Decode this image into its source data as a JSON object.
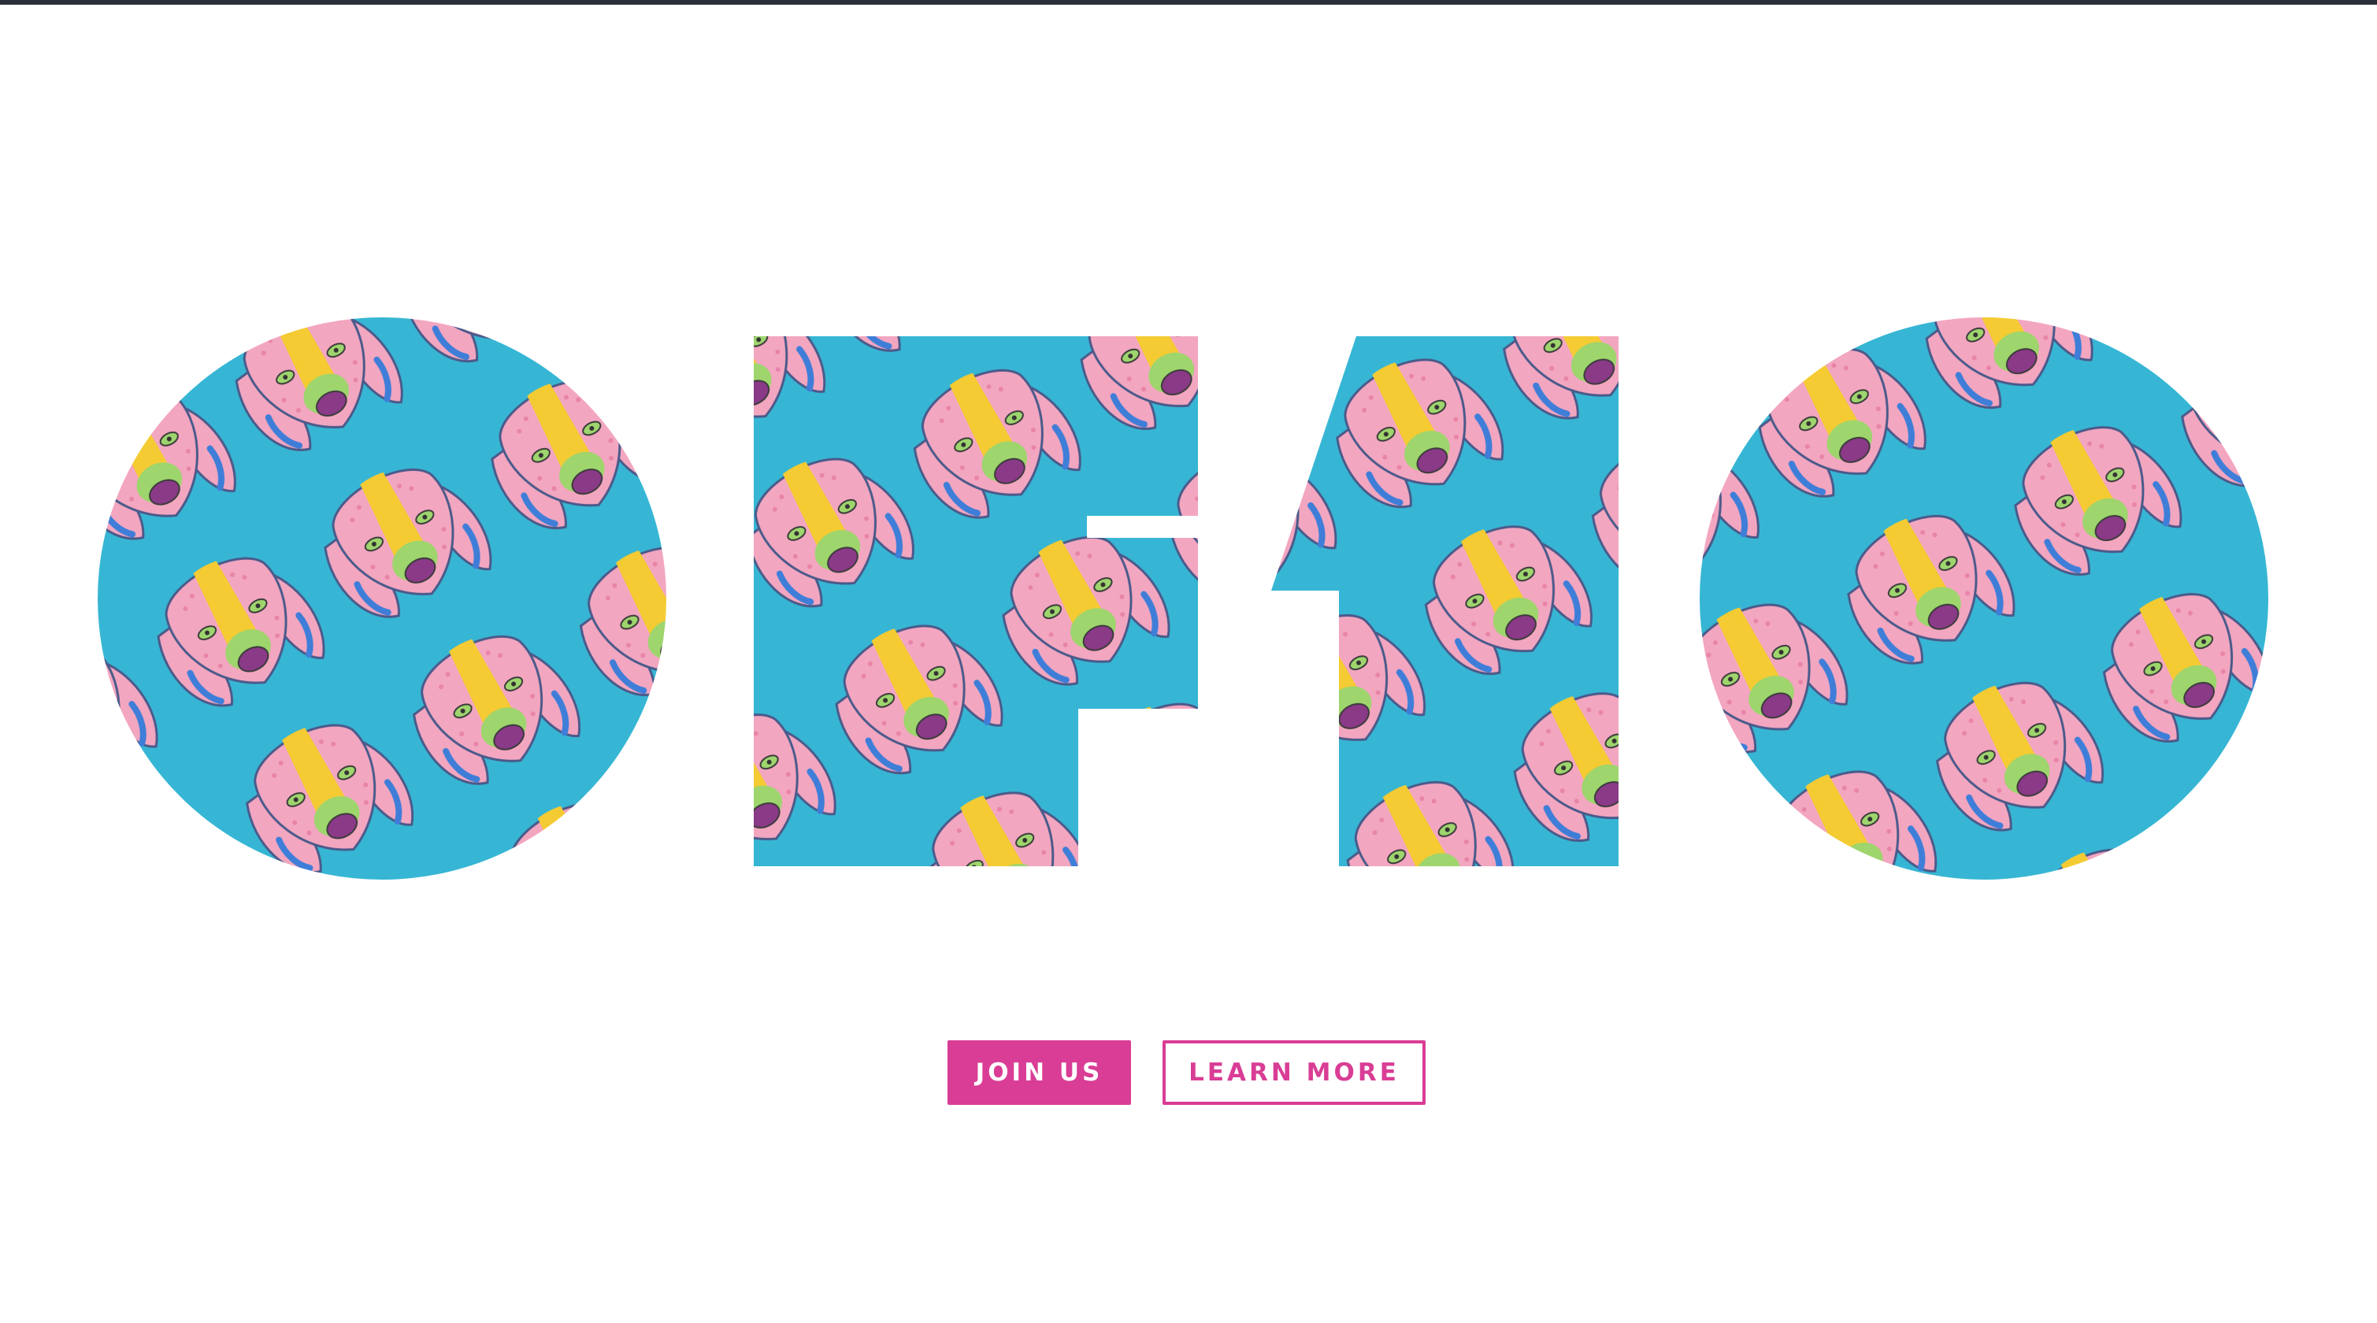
{
  "hero": {
    "logo_letters": [
      "O",
      "F",
      "1",
      "O"
    ],
    "pattern": "pink-dog-heads-on-turquoise",
    "colors": {
      "pattern_bg": "#36b6d4",
      "dog_pink": "#f3a6c0",
      "dog_yellow": "#f4cb33",
      "dog_green": "#9ed56d",
      "dog_purple": "#8a3a86",
      "dog_blue": "#3f7ed8"
    }
  },
  "actions": {
    "join_label": "JOIN US",
    "learn_label": "LEARN MORE"
  },
  "theme": {
    "accent": "#d93d95",
    "top_bar": "#2a3039",
    "background": "#ffffff"
  }
}
